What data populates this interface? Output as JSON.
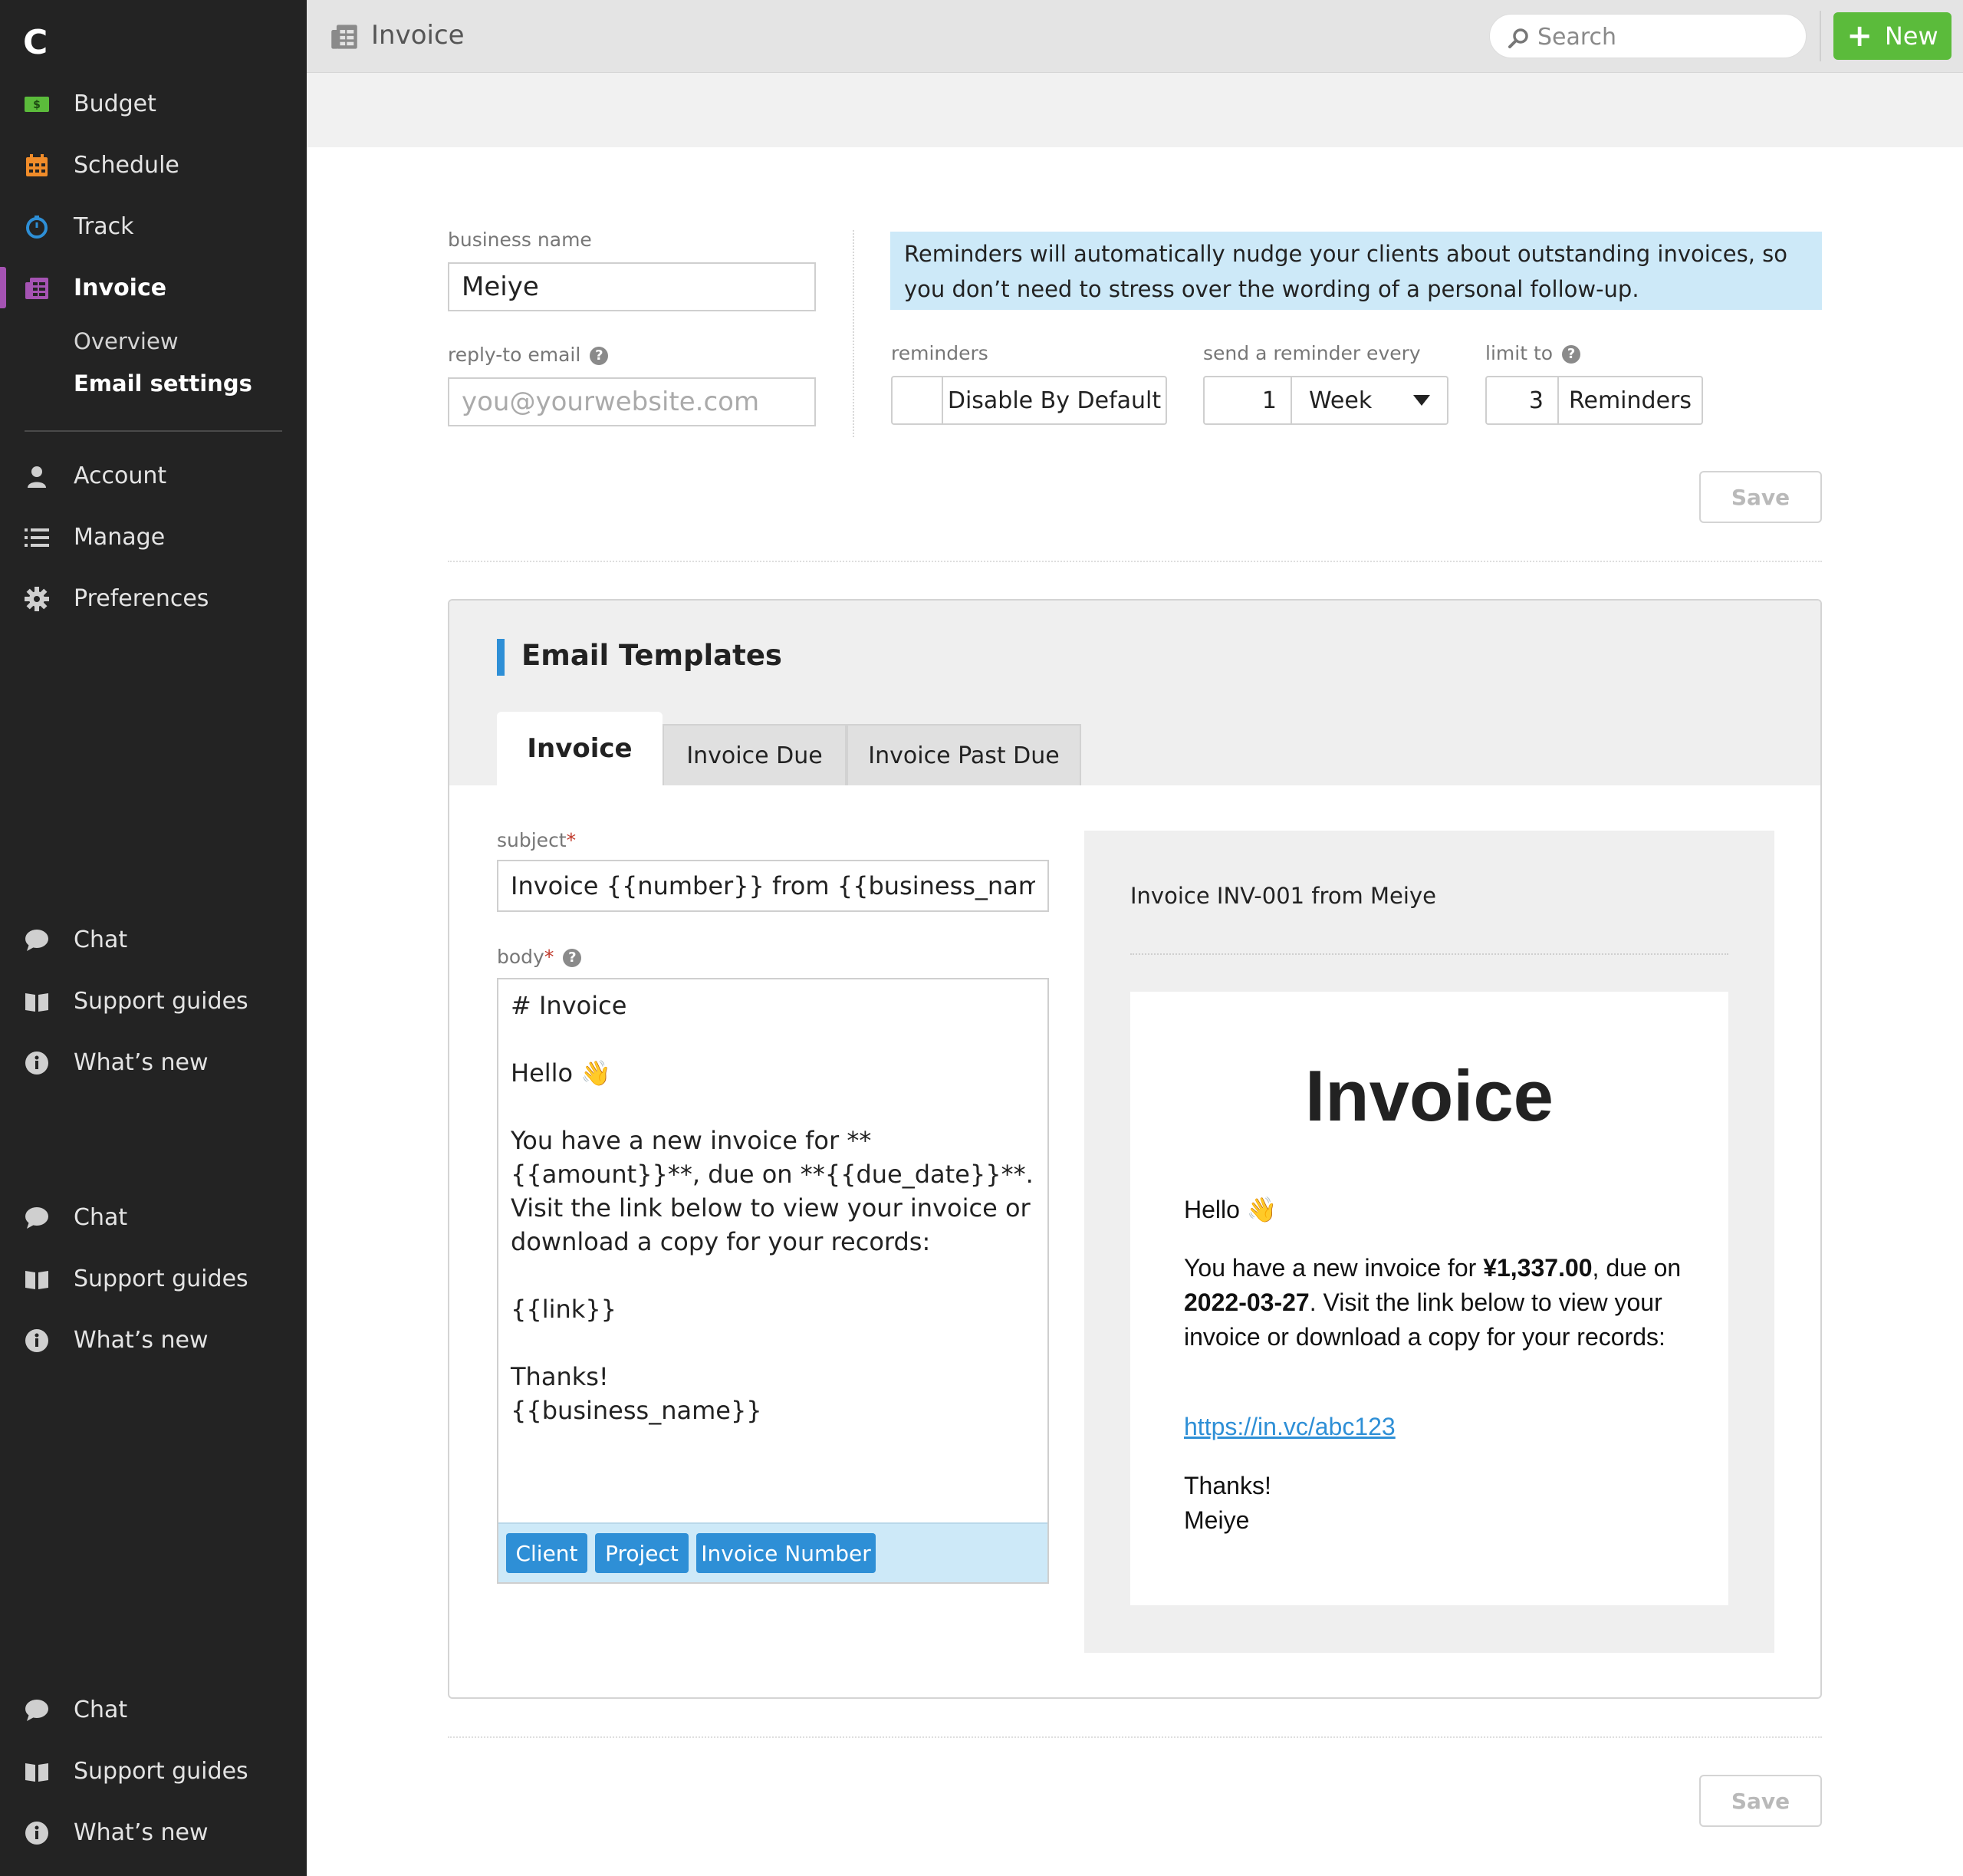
{
  "app": {
    "logo": "C",
    "accent_purple": "#a553b3",
    "accent_green": "#5bbb3b",
    "accent_blue": "#2e8fd6"
  },
  "sidebar": {
    "items": [
      {
        "label": "Budget",
        "icon": "budget-icon"
      },
      {
        "label": "Schedule",
        "icon": "calendar-icon"
      },
      {
        "label": "Track",
        "icon": "timer-icon"
      },
      {
        "label": "Invoice",
        "icon": "invoice-icon",
        "active": true
      }
    ],
    "sub_items": [
      {
        "label": "Overview"
      },
      {
        "label": "Email settings",
        "active": true
      }
    ],
    "secondary": [
      {
        "label": "Account",
        "icon": "person-icon"
      },
      {
        "label": "Manage",
        "icon": "list-icon"
      },
      {
        "label": "Preferences",
        "icon": "gear-icon"
      }
    ],
    "help_groups": [
      {
        "chat": "Chat",
        "guides": "Support guides",
        "news": "What’s new"
      },
      {
        "chat": "Chat",
        "guides": "Support guides",
        "news": "What’s new"
      },
      {
        "chat": "Chat",
        "guides": "Support guides",
        "news": "What’s new"
      }
    ]
  },
  "header": {
    "title": "Invoice",
    "search_placeholder": "Search",
    "new_label": "New"
  },
  "settings": {
    "business_name_label": "business name",
    "business_name_value": "Meiye",
    "reply_to_label": "reply-to email",
    "reply_to_placeholder": "you@yourwebsite.com",
    "info": "Reminders will automatically nudge your clients about outstanding invoices, so you don’t need to stress over the wording of a personal follow-up.",
    "reminders_label": "reminders",
    "reminders_value": "Disable By Default",
    "send_every_label": "send a reminder every",
    "send_every_number": "1",
    "send_every_unit": "Week",
    "limit_label": "limit to",
    "limit_number": "3",
    "limit_unit": "Reminders",
    "save_label": "Save"
  },
  "templates": {
    "title": "Email Templates",
    "tabs": [
      "Invoice",
      "Invoice Due",
      "Invoice Past Due"
    ],
    "subject_label": "subject",
    "subject_value": "Invoice {{number}} from {{business_name}}",
    "body_label": "body",
    "required_mark": "*",
    "body_value": "# Invoice\n\nHello 👋\n\nYou have a new invoice for **{{amount}}**, due on **{{due_date}}**. Visit the link below to view your invoice or download a copy for your records:\n\n{{link}}\n\nThanks!\n{{business_name}}",
    "tags": [
      "Client",
      "Project",
      "Invoice Number"
    ],
    "save_label": "Save"
  },
  "preview": {
    "subject": "Invoice INV-001 from Meiye",
    "heading": "Invoice",
    "greeting": "Hello 👋",
    "line_prefix": "You have a new invoice for ",
    "amount": "¥1,337.00",
    "line_mid": ", due on ",
    "due_date": "2022-03-27",
    "line_suffix": ". Visit the link below to view your invoice or download a copy for your records:",
    "link": "https://in.vc/abc123",
    "thanks": "Thanks!",
    "signature": "Meiye"
  }
}
